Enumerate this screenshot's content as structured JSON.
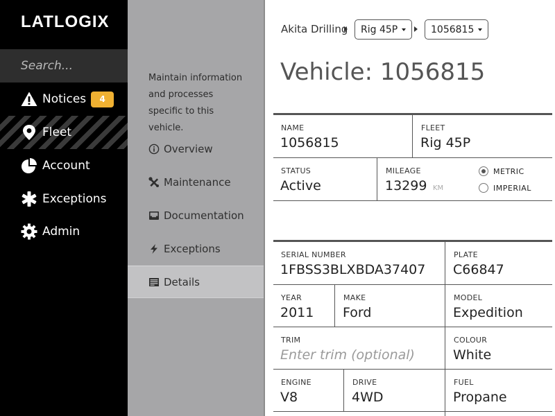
{
  "app": {
    "logo": "LATLOGIX"
  },
  "search": {
    "placeholder": "Search..."
  },
  "nav": {
    "items": [
      {
        "label": "Notices",
        "icon": "warning-icon",
        "badge": "4"
      },
      {
        "label": "Fleet",
        "icon": "map-pin-icon",
        "active": true
      },
      {
        "label": "Account",
        "icon": "pie-chart-icon"
      },
      {
        "label": "Exceptions",
        "icon": "asterisk-icon"
      },
      {
        "label": "Admin",
        "icon": "gear-icon"
      }
    ]
  },
  "subnav": {
    "description": "Maintain information and processes specific to this vehicle.",
    "items": [
      {
        "label": "Overview",
        "icon": "info-icon"
      },
      {
        "label": "Maintenance",
        "icon": "wrench-icon"
      },
      {
        "label": "Documentation",
        "icon": "inbox-icon"
      },
      {
        "label": "Exceptions",
        "icon": "lightning-icon"
      },
      {
        "label": "Details",
        "icon": "list-icon",
        "active": true
      }
    ]
  },
  "breadcrumb": {
    "root": "Akita Drilling",
    "fleet": "Rig 45P",
    "vehicle": "1056815"
  },
  "page": {
    "title": "Vehicle: 1056815"
  },
  "summary": {
    "name": {
      "label": "NAME",
      "value": "1056815"
    },
    "fleet": {
      "label": "FLEET",
      "value": "Rig 45P"
    },
    "status": {
      "label": "STATUS",
      "value": "Active"
    },
    "mileage": {
      "label": "MILEAGE",
      "value": "13299",
      "unit": "KM"
    },
    "units": {
      "metric": "METRIC",
      "imperial": "IMPERIAL",
      "selected": "metric"
    }
  },
  "details": {
    "serial": {
      "label": "SERIAL NUMBER",
      "value": "1FBSS3BLXBDA37407"
    },
    "plate": {
      "label": "PLATE",
      "value": "C66847"
    },
    "year": {
      "label": "YEAR",
      "value": "2011"
    },
    "make": {
      "label": "MAKE",
      "value": "Ford"
    },
    "model": {
      "label": "MODEL",
      "value": "Expedition"
    },
    "trim": {
      "label": "TRIM",
      "placeholder": "Enter trim (optional)"
    },
    "colour": {
      "label": "COLOUR",
      "value": "White"
    },
    "engine": {
      "label": "ENGINE",
      "value": "V8"
    },
    "drive": {
      "label": "DRIVE",
      "value": "4WD"
    },
    "fuel": {
      "label": "FUEL",
      "value": "Propane"
    }
  },
  "colors": {
    "badge": "#f0b132",
    "nav_bg": "#000000",
    "subnav_bg": "#a6a6a8"
  }
}
